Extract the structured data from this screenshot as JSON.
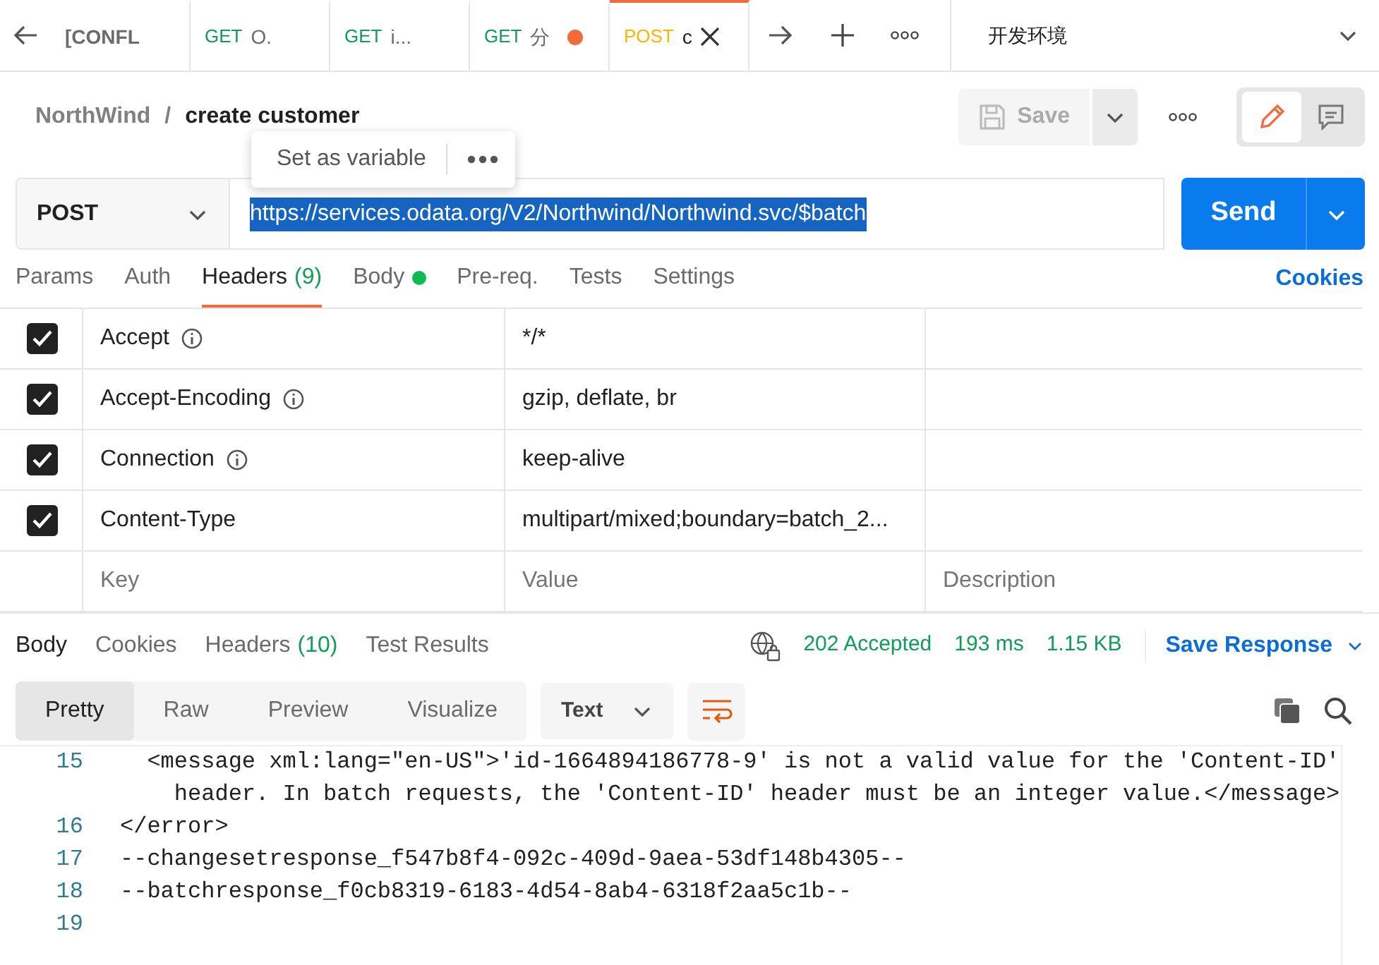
{
  "tabs": [
    {
      "kind": "back"
    },
    {
      "kind": "request",
      "label": "[CONFL",
      "unsaved": false,
      "selected": false
    },
    {
      "kind": "request",
      "method": "GET",
      "label": "O.",
      "unsaved": false,
      "selected": false
    },
    {
      "kind": "request",
      "method": "GET",
      "label": "i...",
      "unsaved": false,
      "selected": false
    },
    {
      "kind": "request",
      "method": "GET",
      "label": "分",
      "unsaved": true,
      "selected": false
    },
    {
      "kind": "request",
      "method": "POST",
      "label": "c",
      "unsaved": false,
      "selected": true
    }
  ],
  "environment": "开发环境",
  "breadcrumb": {
    "collection": "NorthWind",
    "separator": "/",
    "request": "create customer"
  },
  "save_button": {
    "label": "Save",
    "disabled": true
  },
  "popup": {
    "label": "Set as variable"
  },
  "view_toggle": [
    {
      "kind": "edit",
      "selected": true
    },
    {
      "kind": "comments",
      "selected": false
    }
  ],
  "request": {
    "method": "POST",
    "url": "https://services.odata.org/V2/Northwind/Northwind.svc/$batch",
    "send": "Send"
  },
  "request_tabs": [
    {
      "label": "Params",
      "selected": false
    },
    {
      "label": "Auth",
      "selected": false
    },
    {
      "label": "Headers",
      "count": "(9)",
      "selected": true
    },
    {
      "label": "Body",
      "dot": true,
      "selected": false
    },
    {
      "label": "Pre-req.",
      "selected": false
    },
    {
      "label": "Tests",
      "selected": false
    },
    {
      "label": "Settings",
      "selected": false
    }
  ],
  "cookies_link": "Cookies",
  "headers": [
    {
      "checked": true,
      "key": "Accept",
      "info": true,
      "value": "*/*"
    },
    {
      "checked": true,
      "key": "Accept-Encoding",
      "info": true,
      "value": "gzip, deflate, br"
    },
    {
      "checked": true,
      "key": "Connection",
      "info": true,
      "value": "keep-alive"
    },
    {
      "checked": true,
      "key": "Content-Type",
      "value": "multipart/mixed;boundary=batch_2..."
    }
  ],
  "header_placeholders": {
    "key_placeholder": "Key",
    "value_placeholder": "Value",
    "description_placeholder": "Description"
  },
  "response_tabs": [
    {
      "label": "Body",
      "selected": true
    },
    {
      "label": "Cookies",
      "selected": false
    },
    {
      "label": "Headers",
      "count": "(10)",
      "selected": false
    },
    {
      "label": "Test Results",
      "selected": false
    }
  ],
  "response_status": {
    "status": "202 Accepted",
    "time": "193 ms",
    "size": "1.15 KB",
    "save": "Save Response"
  },
  "view_modes": [
    {
      "label": "Pretty",
      "selected": true
    },
    {
      "label": "Raw",
      "selected": false
    },
    {
      "label": "Preview",
      "selected": false
    },
    {
      "label": "Visualize",
      "selected": false
    }
  ],
  "format": "Text",
  "code_lines": [
    {
      "number": "15",
      "text": "  <message xml:lang=\"en-US\">'id-1664894186778-9' is not a valid value for the 'Content-ID'"
    },
    {
      "text": "    header. In batch requests, the 'Content-ID' header must be an integer value.</message>"
    },
    {
      "number": "16",
      "text": "</error>"
    },
    {
      "number": "17",
      "text": "--changesetresponse_f547b8f4-092c-409d-9aea-53df148b4305--"
    },
    {
      "number": "18",
      "text": "--batchresponse_f0cb8319-6183-4d54-8ab4-6318f2aa5c1b--"
    },
    {
      "number": "19"
    }
  ]
}
